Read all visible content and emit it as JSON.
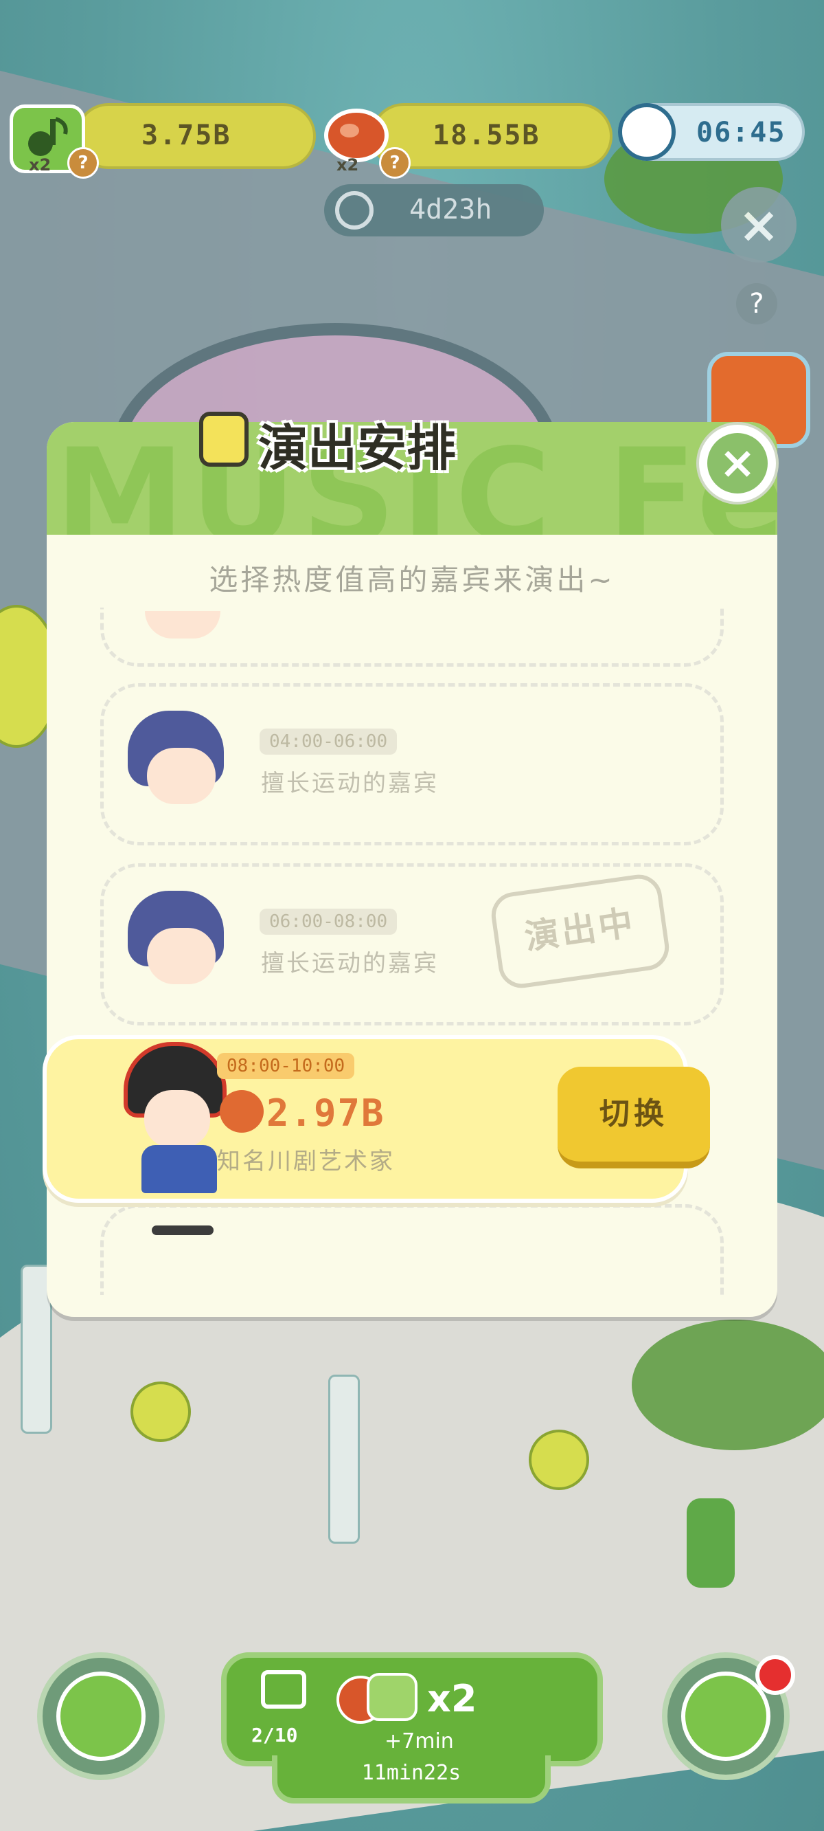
{
  "resources": {
    "music": {
      "value": "3.75B",
      "multiplier": "x2",
      "help": "?"
    },
    "food": {
      "value": "18.55B",
      "multiplier": "x2",
      "help": "?"
    },
    "clock": {
      "value": "06:45"
    },
    "event_timer": "4d23h"
  },
  "side_buttons": {
    "close": "×",
    "help": "?"
  },
  "modal": {
    "title": "演出安排",
    "background_text": "MUSIC Fes",
    "subtitle": "选择热度值高的嘉宾来演出~",
    "close": "×",
    "slots": [
      {
        "time": "04:00-06:00",
        "desc": "擅长运动的嘉宾"
      },
      {
        "time": "06:00-08:00",
        "desc": "擅长运动的嘉宾",
        "stamp": "演出中"
      }
    ],
    "active": {
      "time": "08:00-10:00",
      "value": "2.97B",
      "desc": "知名川剧艺术家",
      "button": "切换"
    }
  },
  "bottom": {
    "ad": {
      "progress": "2/10",
      "multiplier": "x2",
      "bonus": "+7min",
      "timer": "11min22s"
    }
  },
  "colors": {
    "accent_green": "#67b23a",
    "modal_bg": "#fbfbe8",
    "button_yellow": "#f0c830",
    "value_orange": "#e0783a"
  }
}
